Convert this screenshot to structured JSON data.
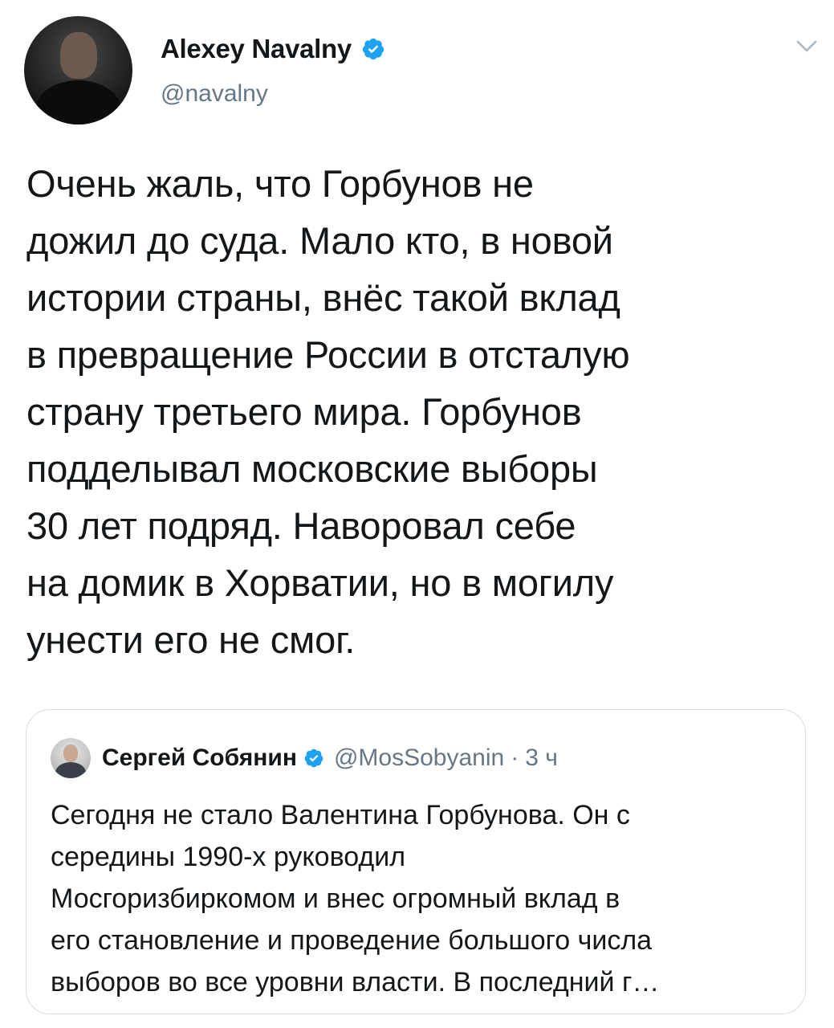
{
  "tweet": {
    "author": {
      "display_name": "Alexey Navalny",
      "handle": "@navalny",
      "verified": true,
      "avatar_icon": "profile-photo"
    },
    "text": "Очень жаль, что Горбунов не\nдожил до суда. Мало кто, в новой\nистории страны, внёс такой вклад\nв превращение России в отсталую\nстрану третьего мира. Горбунов\nподделывал московские выборы\n30 лет подряд. Наворовал себе\nна домик в Хорватии, но в могилу\nунести его не смог.",
    "menu_icon": "chevron-down-icon"
  },
  "quoted_tweet": {
    "author": {
      "display_name": "Сергей Собянин",
      "handle": "@MosSobyanin",
      "verified": true
    },
    "separator": "·",
    "time": "3 ч",
    "text": "Сегодня не стало Валентина Горбунова. Он с\nсередины 1990-х руководил\nМосгоризбиркомом и внес огромный вклад в\nего становление и проведение большого числа\nвыборов во все уровни власти. В последний г…"
  },
  "colors": {
    "verified_blue": "#1da1f2",
    "secondary_text": "#657786",
    "primary_text": "#14171a",
    "border": "#dadee2"
  }
}
